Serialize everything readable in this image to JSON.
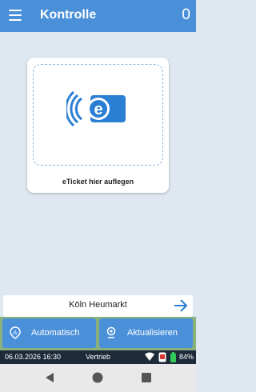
{
  "appbar": {
    "title": "Kontrolle",
    "count": "0"
  },
  "card": {
    "label": "eTicket hier auflegen",
    "icon": "eticket-nfc-icon"
  },
  "station": {
    "name": "Köln Heumarkt"
  },
  "buttons": {
    "auto": "Automatisch",
    "refresh": "Aktualisieren"
  },
  "status": {
    "datetime": "06.03.2026 16:30",
    "department": "Vertrieb",
    "battery": "84%"
  },
  "colors": {
    "primary": "#4a90d9",
    "background": "#dfe7f0",
    "status_bar": "#1d2a3a"
  }
}
